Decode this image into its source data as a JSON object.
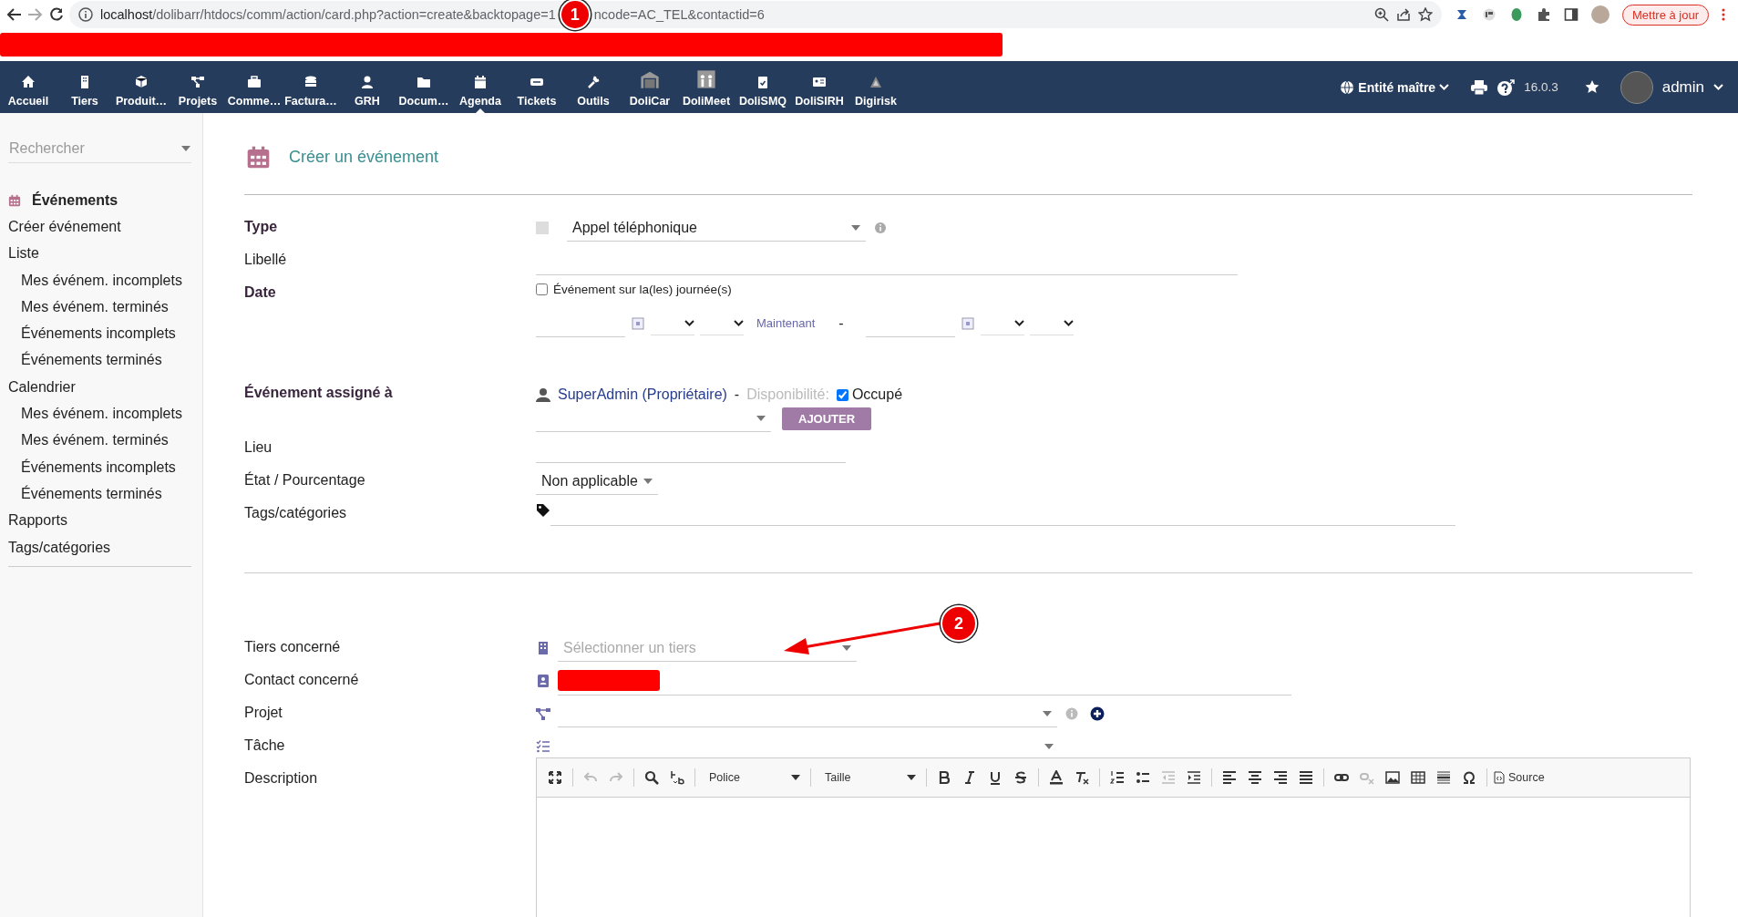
{
  "browser": {
    "url_host": "localhost",
    "url_path": "/dolibarr/htdocs/comm/action/card.php?action=create&backtopage=1",
    "url_tail": "ncode=AC_TEL&contactid=6",
    "update_button": "Mettre à jour"
  },
  "annotations": [
    {
      "label": "1"
    },
    {
      "label": "2"
    }
  ],
  "nav": {
    "items": [
      {
        "label": "Accueil",
        "selected": false
      },
      {
        "label": "Tiers",
        "selected": false
      },
      {
        "label": "Produit…",
        "selected": false
      },
      {
        "label": "Projets",
        "selected": false
      },
      {
        "label": "Comme…",
        "selected": false
      },
      {
        "label": "Factura…",
        "selected": false
      },
      {
        "label": "GRH",
        "selected": false
      },
      {
        "label": "Docum…",
        "selected": false
      },
      {
        "label": "Agenda",
        "selected": true
      },
      {
        "label": "Tickets",
        "selected": false
      },
      {
        "label": "Outils",
        "selected": false
      },
      {
        "label": "DoliCar",
        "selected": false
      },
      {
        "label": "DoliMeet",
        "selected": false
      },
      {
        "label": "DoliSMQ",
        "selected": false
      },
      {
        "label": "DoliSIRH",
        "selected": false
      },
      {
        "label": "Digirisk",
        "selected": false
      }
    ],
    "entity": "Entité maître",
    "version": "16.0.3",
    "user": "admin"
  },
  "sidebar": {
    "search_placeholder": "Rechercher",
    "menu": [
      {
        "label": "Événements",
        "kind": "title"
      },
      {
        "label": "Créer événement",
        "kind": "link"
      },
      {
        "label": "Liste",
        "kind": "link",
        "children": [
          {
            "label": "Mes événem. incomplets",
            "kind": "link"
          },
          {
            "label": "Mes événem. terminés",
            "kind": "link"
          },
          {
            "label": "Événements incomplets",
            "kind": "link"
          },
          {
            "label": "Événements terminés",
            "kind": "link"
          }
        ]
      },
      {
        "label": "Calendrier",
        "kind": "link",
        "children": [
          {
            "label": "Mes événem. incomplets",
            "kind": "link"
          },
          {
            "label": "Mes événem. terminés",
            "kind": "link"
          },
          {
            "label": "Événements incomplets",
            "kind": "link"
          },
          {
            "label": "Événements terminés",
            "kind": "link"
          }
        ]
      },
      {
        "label": "Rapports",
        "kind": "link"
      },
      {
        "label": "Tags/catégories",
        "kind": "link"
      }
    ]
  },
  "page": {
    "title": "Créer un événement",
    "form1": [
      {
        "kind": "type",
        "label": "Type",
        "required": true,
        "value": "Appel téléphonique"
      },
      {
        "kind": "text",
        "label": "Libellé",
        "required": false
      },
      {
        "kind": "date",
        "label": "Date",
        "required": true,
        "fullday_label": "Événement sur la(les) journée(s)",
        "fullday_checked": false,
        "now_link": "Maintenant",
        "separator": "-"
      },
      {
        "kind": "assignees",
        "label": "Événement assigné à",
        "required": true,
        "user": "SuperAdmin (Propriétaire)",
        "dash": "-",
        "availability_label": "Disponibilité:",
        "busy_checked": true,
        "busy_label": "Occupé",
        "add_button": "AJOUTER",
        "add_disabled": true
      },
      {
        "kind": "shorttext",
        "label": "Lieu",
        "required": false
      },
      {
        "kind": "select",
        "label": "État / Pourcentage",
        "required": false,
        "value": "Non applicable"
      },
      {
        "kind": "tags",
        "label": "Tags/catégories",
        "required": false
      }
    ],
    "form2": [
      {
        "kind": "thirdparty",
        "label": "Tiers concerné",
        "required": false,
        "placeholder": "Sélectionner un tiers"
      },
      {
        "kind": "contact",
        "label": "Contact concerné",
        "required": false
      },
      {
        "kind": "project",
        "label": "Projet",
        "required": false
      },
      {
        "kind": "task",
        "label": "Tâche",
        "required": false
      },
      {
        "kind": "editor",
        "label": "Description",
        "required": false,
        "font": "Police",
        "size": "Taille",
        "source": "Source"
      }
    ]
  }
}
